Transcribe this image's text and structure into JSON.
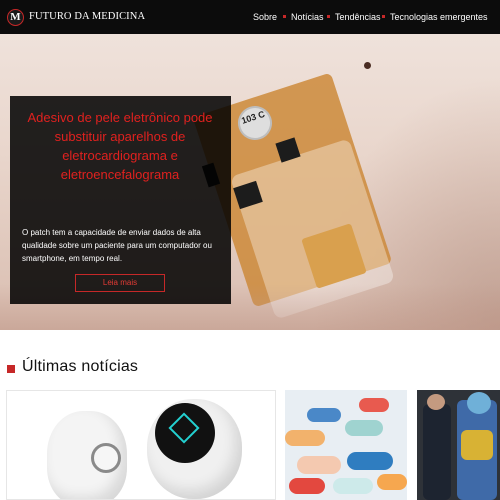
{
  "header": {
    "logo_letter": "M",
    "brand": "FUTURO DA MEDICINA",
    "nav": [
      "Sobre",
      "Notícias",
      "Tendências",
      "Tecnologias emergentes"
    ]
  },
  "hero": {
    "device_label": "103 C",
    "title": "Adesivo de pele eletrônico pode substituir aparelhos de eletrocardiograma e eletroencefalograma",
    "excerpt": "O patch tem a capacidade de enviar dados de alta qualidade sobre um paciente para um computador ou smartphone, em tempo real.",
    "button": "Leia mais"
  },
  "latest": {
    "title": "Últimas notícias"
  },
  "colors": {
    "accent": "#c62828",
    "topbar": "#0c0c0c",
    "feature_bg": "#000000",
    "feature_title": "#e0211f"
  }
}
